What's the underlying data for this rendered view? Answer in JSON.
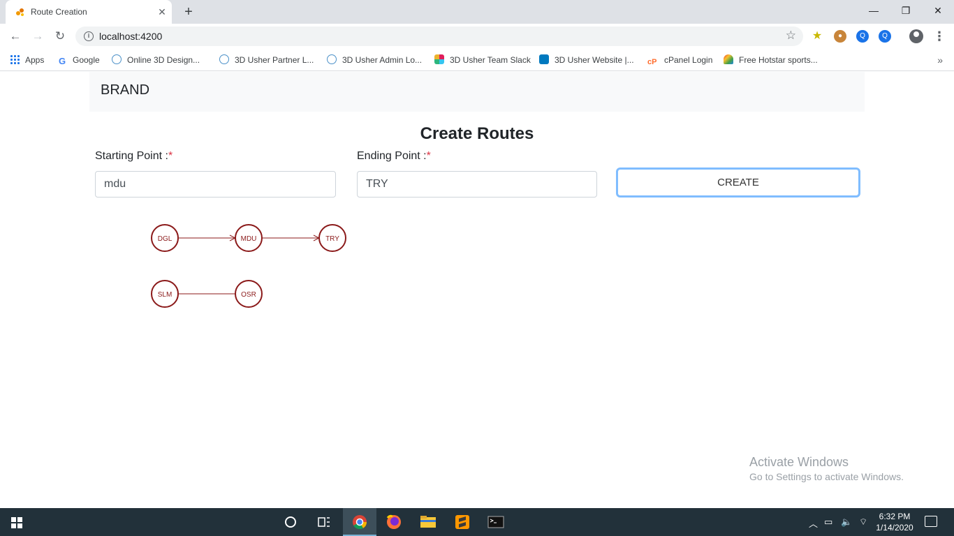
{
  "browser": {
    "tab_title": "Route Creation",
    "tab_close": "✕",
    "new_tab": "+",
    "url": "localhost:4200",
    "window_controls": {
      "minimize": "—",
      "restore": "❐",
      "close": "✕"
    }
  },
  "bookmarks": [
    {
      "label": "Apps",
      "icon": "apps-grid-icon"
    },
    {
      "label": "Google",
      "icon": "google-icon"
    },
    {
      "label": "Online 3D Design...",
      "icon": "3d-usher-icon"
    },
    {
      "label": "3D Usher Partner L...",
      "icon": "3d-usher-icon"
    },
    {
      "label": "3D Usher Admin Lo...",
      "icon": "3d-usher-icon"
    },
    {
      "label": "3D Usher Team Slack",
      "icon": "slack-icon"
    },
    {
      "label": "3D Usher Website |...",
      "icon": "trello-icon"
    },
    {
      "label": "cPanel Login",
      "icon": "cpanel-icon"
    },
    {
      "label": "Free Hotstar sports...",
      "icon": "hotstar-icon"
    }
  ],
  "navbar": {
    "brand": "BRAND"
  },
  "page": {
    "title": "Create Routes",
    "starting_label": "Starting Point :",
    "ending_label": "Ending Point :",
    "required_mark": "*",
    "starting_value": "mdu",
    "ending_value": "TRY",
    "create_button": "CREATE"
  },
  "routes": [
    {
      "nodes": [
        "DGL",
        "MDU",
        "TRY"
      ],
      "directed": true
    },
    {
      "nodes": [
        "SLM",
        "OSR"
      ],
      "directed": false
    }
  ],
  "colors": {
    "node_stroke": "#8b1a1a",
    "button_focus": "#80bdff",
    "required": "#dc3545"
  },
  "watermark": {
    "title": "Activate Windows",
    "subtitle": "Go to Settings to activate Windows."
  },
  "taskbar": {
    "time": "6:32 PM",
    "date": "1/14/2020"
  }
}
